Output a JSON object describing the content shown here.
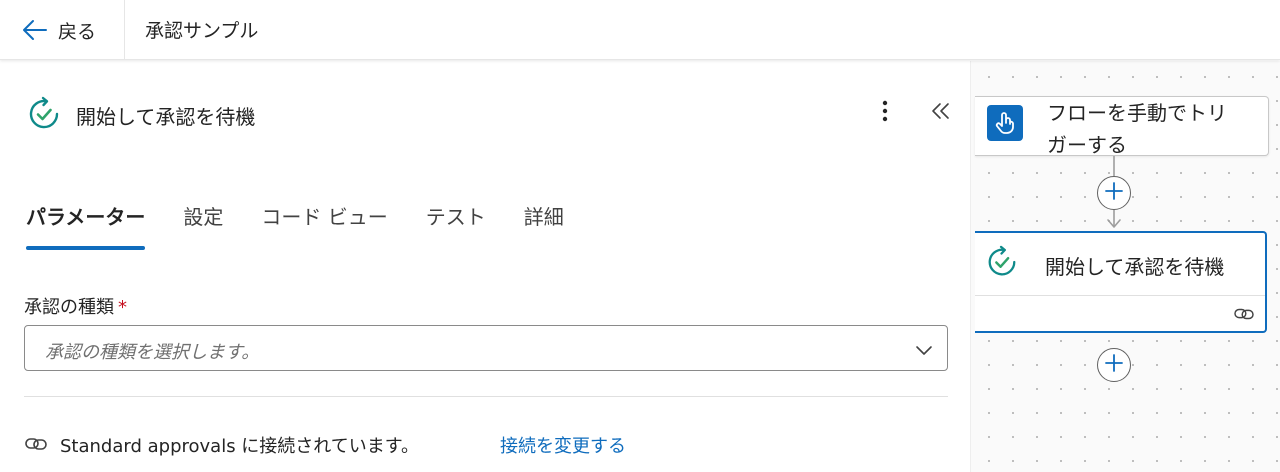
{
  "topbar": {
    "back_label": "戻る",
    "flow_title": "承認サンプル"
  },
  "panel": {
    "title": "開始して承認を待機",
    "tabs": [
      {
        "label": "パラメーター",
        "active": true
      },
      {
        "label": "設定",
        "active": false
      },
      {
        "label": "コード ビュー",
        "active": false
      },
      {
        "label": "テスト",
        "active": false
      },
      {
        "label": "詳細",
        "active": false
      }
    ],
    "approval_type": {
      "label": "承認の種類",
      "required_mark": "*",
      "placeholder": "承認の種類を選択します。"
    },
    "connection": {
      "text": "Standard approvals に接続されています。",
      "change_link": "接続を変更する"
    }
  },
  "canvas": {
    "trigger_node": {
      "label": "フローを手動でトリガーする",
      "line1": "フローを手動でトリ",
      "line2": "ガーする"
    },
    "approval_node": {
      "label": "開始して承認を待機"
    }
  },
  "icons": {
    "back": "arrow-left-icon",
    "approval": "approval-clock-check-icon",
    "more": "more-vertical-icon",
    "collapse": "double-chevron-left-icon",
    "chevron": "chevron-down-icon",
    "connection": "link-icon",
    "trigger": "hand-touch-icon",
    "add": "plus-circle-icon"
  },
  "colors": {
    "accent": "#0f6cbd",
    "required": "#c50f1f",
    "approval_teal": "#0f8a8a",
    "approval_green": "#2fa36b"
  }
}
